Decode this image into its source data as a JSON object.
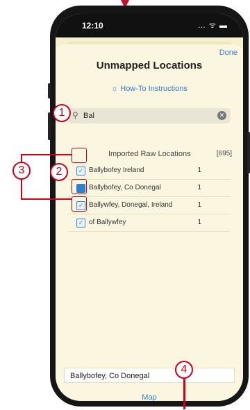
{
  "status_bar": {
    "time": "12:10",
    "icons": "… ᯤ ▬"
  },
  "sheet": {
    "done_label": "Done",
    "title": "Unmapped Locations",
    "howto_label": "How-To Instructions",
    "search": {
      "value": "Bal"
    },
    "list": {
      "header": "Imported Raw Locations",
      "total": "[695]",
      "rows": [
        {
          "name": "Ballybofey Ireland",
          "count": "1",
          "state": "checked"
        },
        {
          "name": "Ballybofey, Co Donegal",
          "count": "1",
          "state": "selected"
        },
        {
          "name": "Ballywfey, Donegal, Ireland",
          "count": "1",
          "state": "checked"
        },
        {
          "name": "of Ballywfey",
          "count": "1",
          "state": "checked"
        }
      ]
    },
    "selected_location": "Ballybofey, Co Donegal",
    "map_label": "Map"
  },
  "annotations": {
    "a1": "1",
    "a2": "2",
    "a3": "3",
    "a4": "4"
  },
  "colors": {
    "accent": "#2f7fd1",
    "annotation": "#d0021b",
    "background": "#faf6df"
  }
}
